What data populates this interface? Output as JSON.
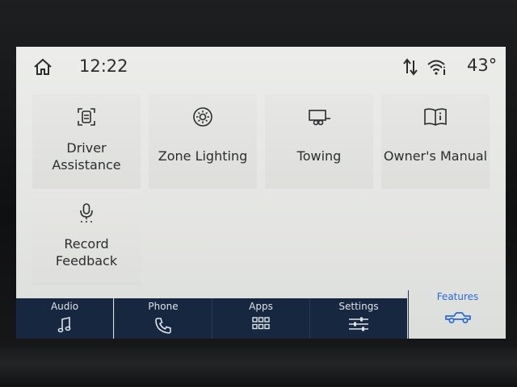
{
  "status_bar": {
    "time": "12:22",
    "temperature": "43°",
    "icons": [
      "home-icon",
      "data-signal-icon",
      "wifi-icon"
    ]
  },
  "tiles": [
    {
      "label_lines": [
        "Driver",
        "Assistance"
      ],
      "icon": "driver-assist-icon"
    },
    {
      "label_lines": [
        "Zone Lighting"
      ],
      "icon": "zone-lighting-icon"
    },
    {
      "label_lines": [
        "Towing"
      ],
      "icon": "trailer-icon"
    },
    {
      "label_lines": [
        "Owner's Manual"
      ],
      "icon": "manual-book-icon"
    },
    {
      "label_lines": [
        "Record",
        "Feedback"
      ],
      "icon": "microphone-icon"
    }
  ],
  "nav": [
    {
      "label": "Audio",
      "icon": "music-note-icon"
    },
    {
      "label": "Phone",
      "icon": "phone-icon"
    },
    {
      "label": "Apps",
      "icon": "apps-grid-icon"
    },
    {
      "label": "Settings",
      "icon": "sliders-icon"
    },
    {
      "label": "Features",
      "icon": "truck-icon",
      "active": true
    }
  ],
  "colors": {
    "nav_background": "#17273f",
    "active_accent": "#2a6ad8",
    "screen_background": "#e8e9e6",
    "text": "#2b2d2f"
  }
}
